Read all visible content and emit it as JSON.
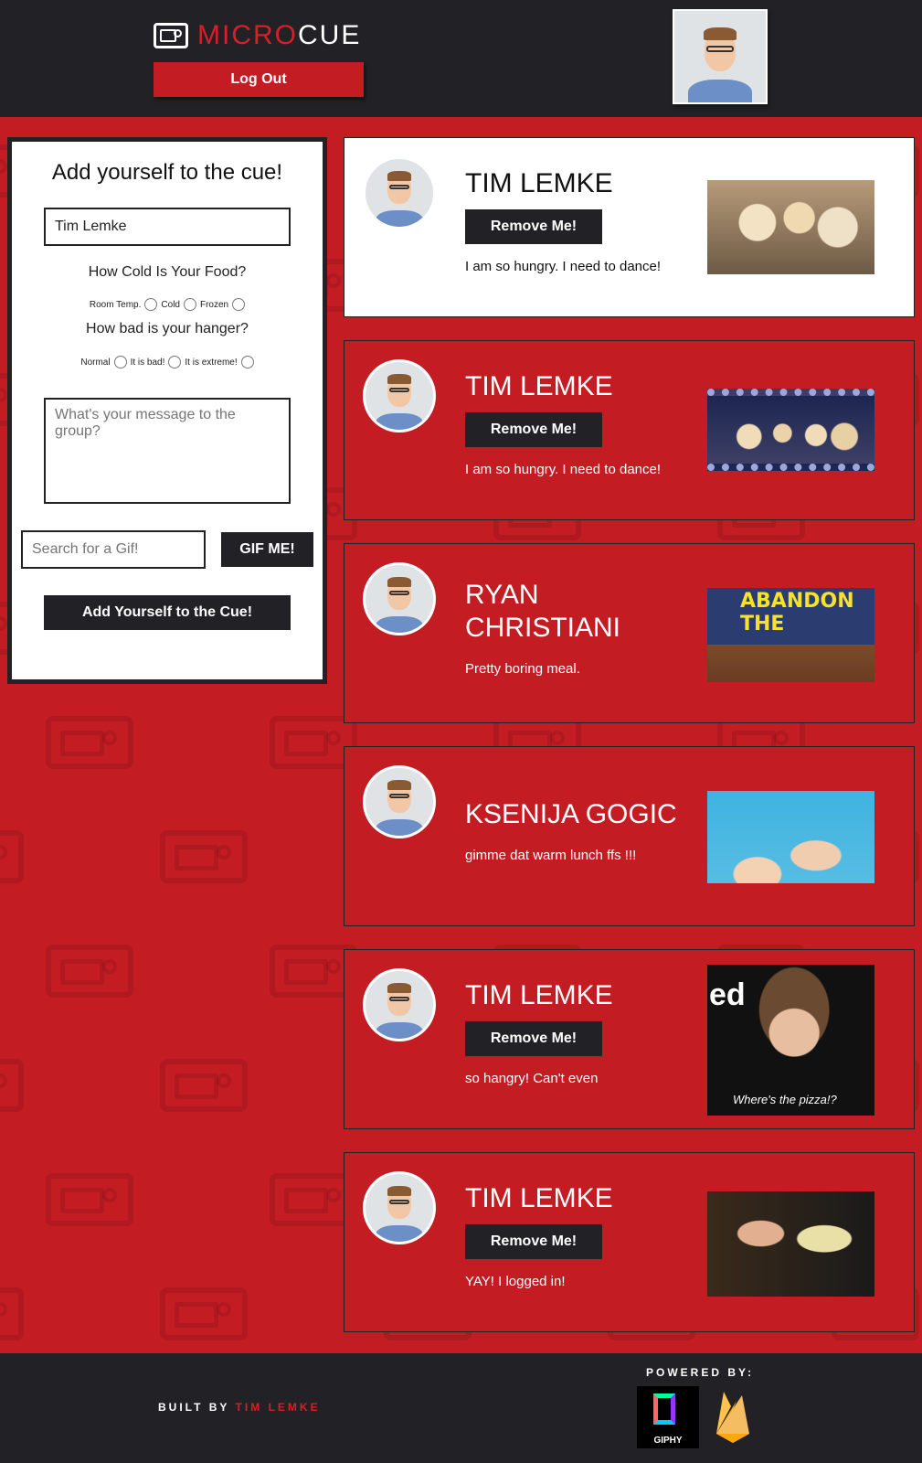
{
  "header": {
    "logo_part1": "MICRO",
    "logo_part2": "CUE",
    "logout_label": "Log Out"
  },
  "form": {
    "title": "Add yourself to the cue!",
    "name_value": "Tim Lemke",
    "food_question": "How Cold Is Your Food?",
    "food_options": [
      "Room Temp.",
      "Cold",
      "Frozen"
    ],
    "hanger_question": "How bad is your hanger?",
    "hanger_options": [
      "Normal",
      "It is bad!",
      "It is extreme!"
    ],
    "message_placeholder": "What's your message to the group?",
    "gif_search_placeholder": "Search for a Gif!",
    "gif_button": "GIF ME!",
    "add_button": "Add Yourself to the Cue!"
  },
  "cue": [
    {
      "name": "TIM LEMKE",
      "remove_label": "Remove Me!",
      "message": "I am so hungry. I need to dance!",
      "style": "white",
      "gif": "puppies"
    },
    {
      "name": "TIM LEMKE",
      "remove_label": "Remove Me!",
      "message": "I am so hungry. I need to dance!",
      "style": "red",
      "gif": "stage"
    },
    {
      "name": "RYAN CHRISTIANI",
      "remove_label": "",
      "message": "Pretty boring meal.",
      "style": "red",
      "gif": "abandon",
      "gif_caption": "ABANDON THE"
    },
    {
      "name": "KSENIJA GOGIC",
      "remove_label": "",
      "message": "gimme dat warm lunch ffs !!!",
      "style": "red",
      "gif": "girls"
    },
    {
      "name": "TIM LEMKE",
      "remove_label": "Remove Me!",
      "message": "so hangry! Can't even",
      "style": "red",
      "gif": "pizza",
      "gif_tag": "ed",
      "gif_caption": "Where's the pizza!?"
    },
    {
      "name": "TIM LEMKE",
      "remove_label": "Remove Me!",
      "message": "YAY! I logged in!",
      "style": "red",
      "gif": "vendetta"
    }
  ],
  "footer": {
    "built_by": "BUILT BY",
    "author": "TIM LEMKE",
    "powered_by": "POWERED BY:",
    "giphy_label": "GIPHY"
  },
  "colors": {
    "brand_red": "#c41c23",
    "dark": "#222226",
    "accent_red_text": "#d42027"
  }
}
